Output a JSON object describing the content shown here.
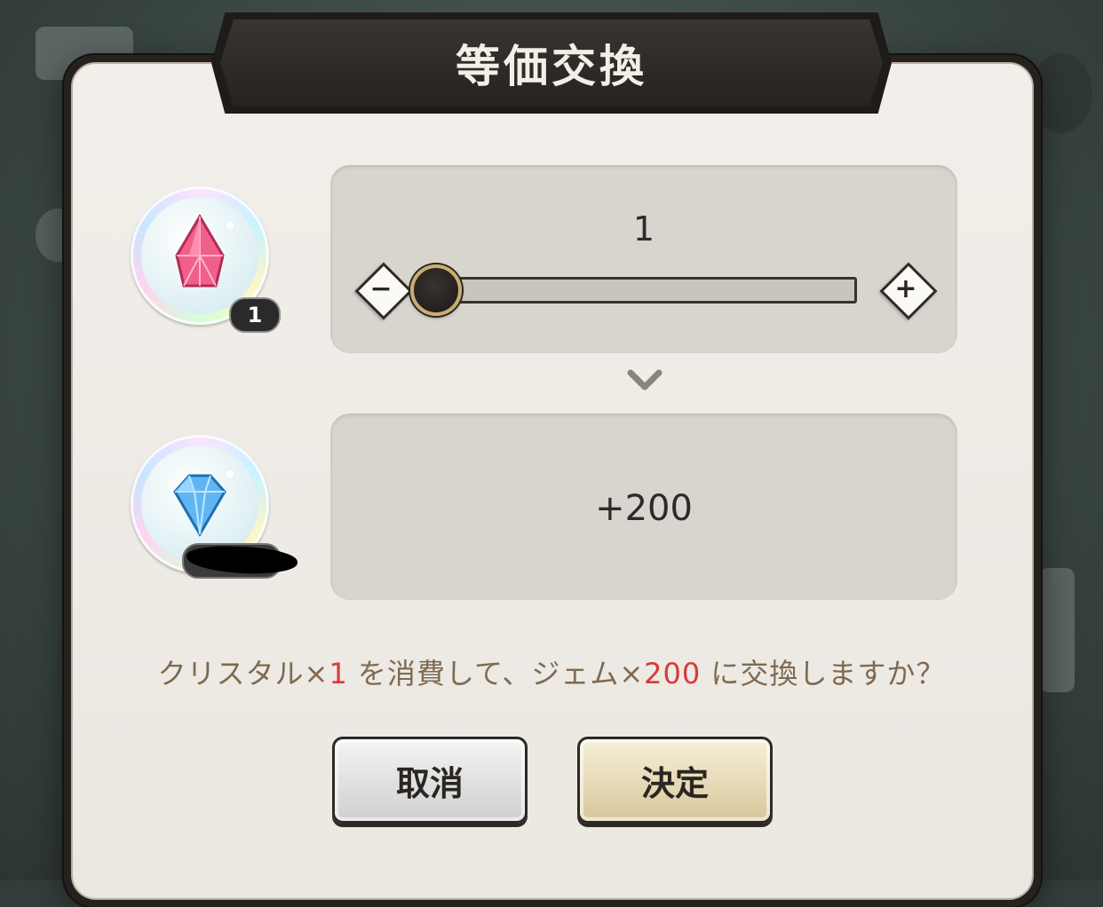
{
  "dialog": {
    "title": "等価交換"
  },
  "source_item": {
    "name_icon": "pink-crystal-icon",
    "count_badge": "1"
  },
  "target_item": {
    "name_icon": "blue-gem-icon",
    "count_badge_redacted": true
  },
  "slider": {
    "value": "1",
    "min": 1,
    "max": 100,
    "minus_icon": "−",
    "plus_icon": "+"
  },
  "result": {
    "value": "+200"
  },
  "confirmation": {
    "prefix": "クリスタル×",
    "spend_amount": "1",
    "middle": " を消費して、ジェム×",
    "gain_amount": "200",
    "suffix": " に交換しますか？"
  },
  "buttons": {
    "cancel_label": "取消",
    "confirm_label": "決定"
  },
  "colors": {
    "highlight_red": "#d8393a",
    "text_brown": "#7f6a4f",
    "knob_gold": "#c8ad72"
  }
}
